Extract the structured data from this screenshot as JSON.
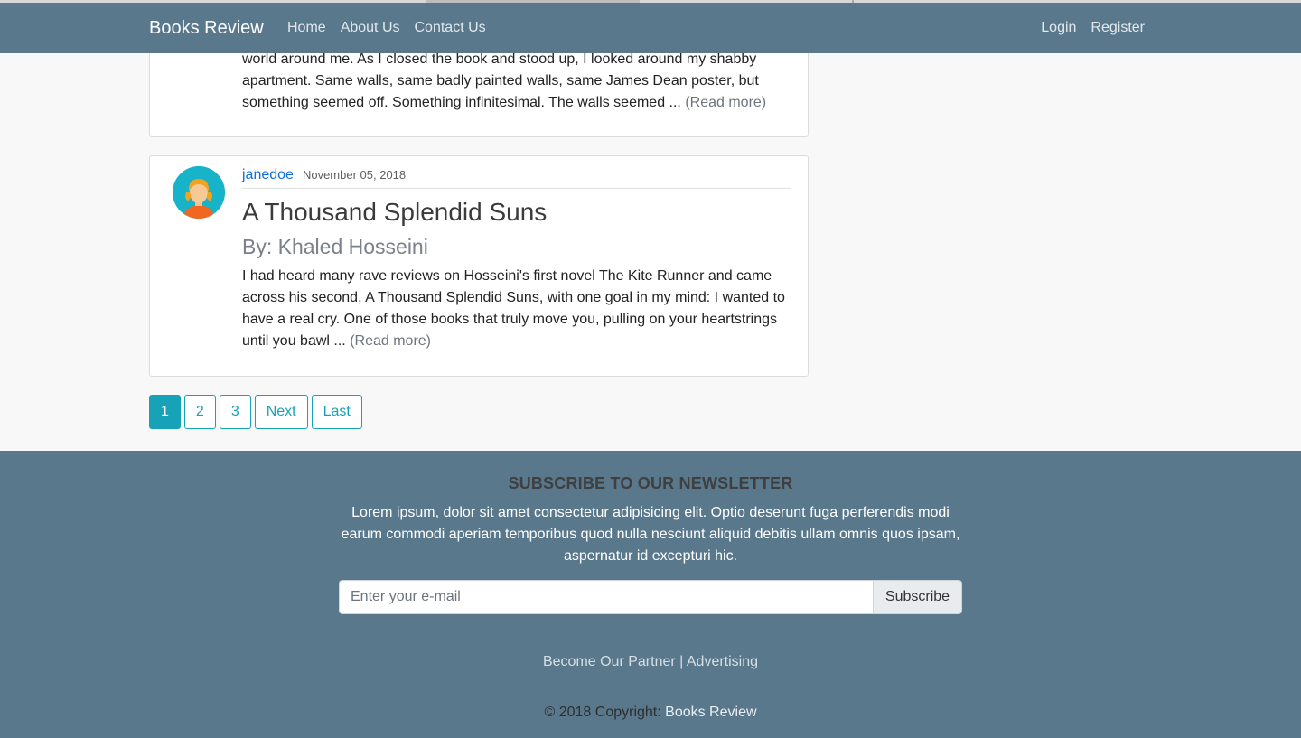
{
  "navbar": {
    "brand": "Books Review",
    "links": [
      "Home",
      "About Us",
      "Contact Us"
    ],
    "login": "Login",
    "register": "Register"
  },
  "posts": [
    {
      "excerpt": "world around me. As I closed the book and stood up, I looked around my shabby apartment. Same walls, same badly painted walls, same James Dean poster, but something seemed off. Something infinitesimal. The walls seemed ...",
      "read_more": "(Read more)"
    },
    {
      "author": "janedoe",
      "date": "November 05, 2018",
      "title": "A Thousand Splendid Suns",
      "byline": "By: Khaled Hosseini",
      "excerpt": "I had heard many rave reviews on Hosseini's first novel The Kite Runner and came across his second, A Thousand Splendid Suns, with one goal in my mind: I wanted to have a real cry. One of those books that truly move you, pulling on your heartstrings until you bawl ...",
      "read_more": "(Read more)"
    }
  ],
  "pagination": {
    "pages": [
      "1",
      "2",
      "3"
    ],
    "active": "1",
    "next": "Next",
    "last": "Last"
  },
  "footer": {
    "newsletter_title": "SUBSCRIBE TO OUR NEWSLETTER",
    "newsletter_text": "Lorem ipsum, dolor sit amet consectetur adipisicing elit. Optio deserunt fuga perferendis modi earum commodi aperiam temporibus quod nulla nesciunt aliquid debitis ullam omnis quos ipsam, aspernatur id excepturi hic.",
    "email_placeholder": "Enter your e-mail",
    "subscribe_label": "Subscribe",
    "partner_link": "Become Our Partner",
    "separator": "|",
    "advertising_link": "Advertising",
    "copyright_prefix": "© 2018 Copyright:",
    "copyright_link": "Books Review"
  },
  "colors": {
    "navbar_bg": "#5a788c",
    "accent": "#17a2b8",
    "author_link": "#0f6fd6"
  }
}
